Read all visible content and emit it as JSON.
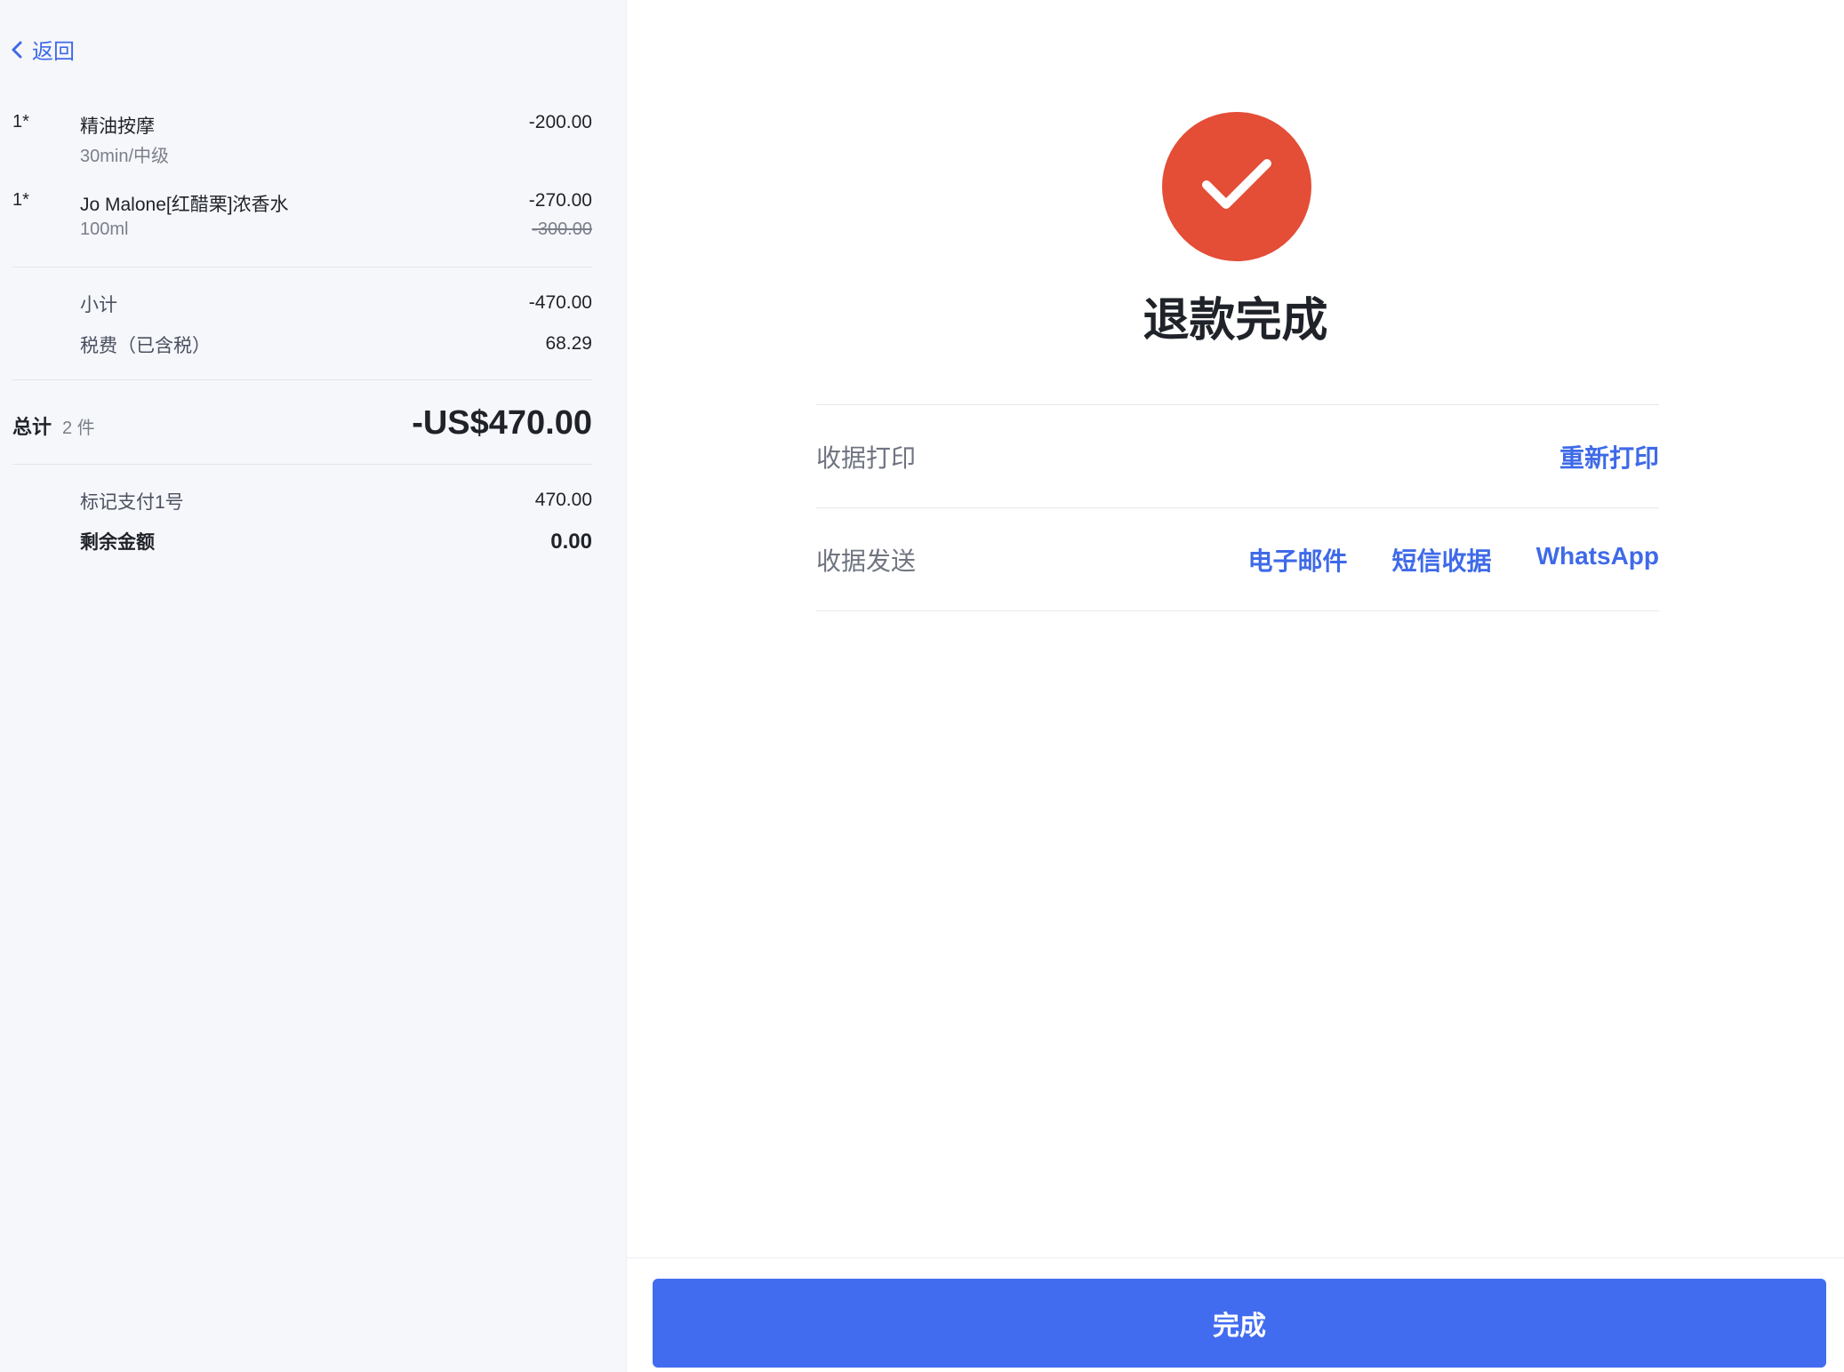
{
  "back": {
    "label": "返回"
  },
  "items": [
    {
      "qty": "1*",
      "name": "精油按摩",
      "sub": "30min/中级",
      "price": "-200.00",
      "original_price": ""
    },
    {
      "qty": "1*",
      "name": "Jo Malone[红醋栗]浓香水",
      "sub": "100ml",
      "price": "-270.00",
      "original_price": "-300.00"
    }
  ],
  "summary": {
    "subtotal_label": "小计",
    "subtotal_value": "-470.00",
    "tax_label": "税费（已含税）",
    "tax_value": "68.29"
  },
  "total": {
    "label": "总计",
    "count": "2 件",
    "value": "-US$470.00"
  },
  "payments": {
    "method_label": "标记支付1号",
    "method_value": "470.00",
    "remaining_label": "剩余金额",
    "remaining_value": "0.00"
  },
  "result": {
    "icon": "check-icon",
    "status_color": "#e44d36",
    "title": "退款完成"
  },
  "receipt": {
    "print_label": "收据打印",
    "reprint": "重新打印",
    "send_label": "收据发送",
    "email": "电子邮件",
    "sms": "短信收据",
    "whatsapp": "WhatsApp"
  },
  "footer": {
    "done_label": "完成"
  },
  "colors": {
    "accent": "#426cf0",
    "link": "#3f6ae8"
  }
}
